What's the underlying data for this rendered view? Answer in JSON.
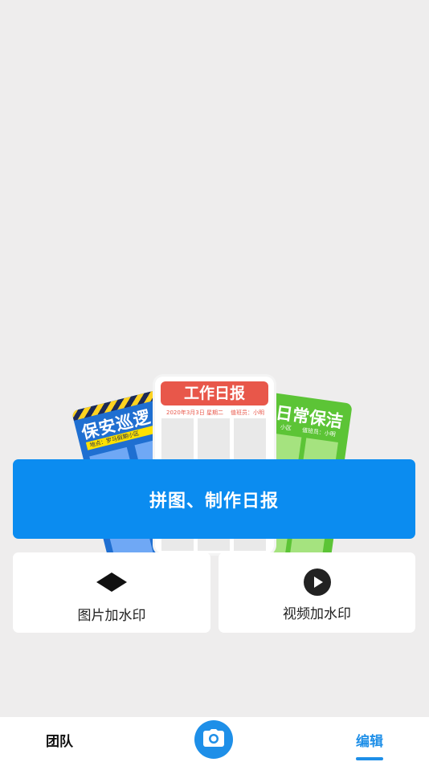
{
  "illustration": {
    "left_card": {
      "title": "保安巡逻",
      "subtitle": "地点：罗马假期小区",
      "color": "#1F6FD1"
    },
    "middle_card": {
      "title": "工作日报",
      "date": "2020年3月3日 星期二",
      "duty": "值班员：小明",
      "color": "#E8574A"
    },
    "right_card": {
      "title": "日常保洁",
      "subtitle_left": "小区",
      "subtitle_right": "值班员：小明",
      "color": "#5CC436"
    }
  },
  "main_button": {
    "label": "拼图、制作日报",
    "color": "#0B8CF0"
  },
  "actions": [
    {
      "label": "图片加水印",
      "icon": "diamond-icon"
    },
    {
      "label": "视频加水印",
      "icon": "play-icon"
    }
  ],
  "tabbar": {
    "team_label": "团队",
    "camera_icon": "camera-icon",
    "edit_label": "编辑",
    "active_color": "#1E8FE8"
  }
}
